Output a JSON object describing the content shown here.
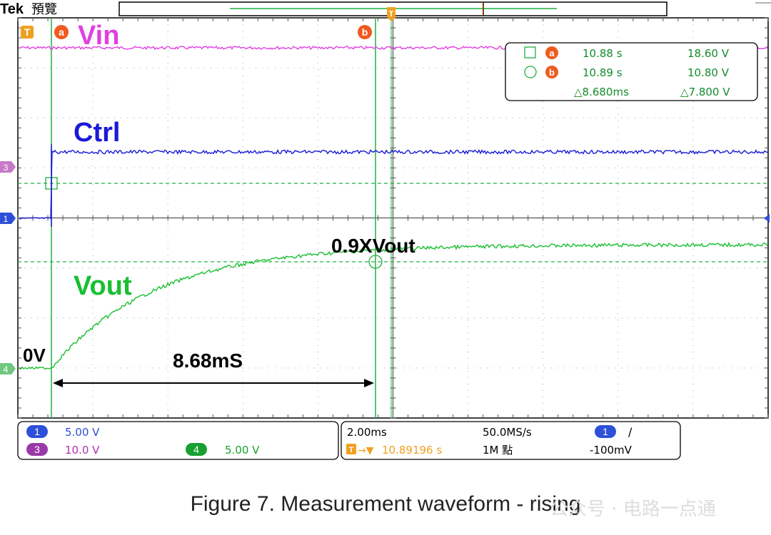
{
  "brand": "Tek",
  "acq_state": "預覽",
  "trace_labels": {
    "vin": "Vin",
    "ctrl": "Ctrl",
    "vout": "Vout"
  },
  "annotations": {
    "zero": "0V",
    "level": "0.9XVout",
    "interval": "8.68mS"
  },
  "cursor_markers": {
    "a": "a",
    "b": "b",
    "trigger": "T"
  },
  "channel_markers": {
    "ch1": "1",
    "ch3": "3",
    "ch4": "4"
  },
  "cursor_readout": {
    "a_time": "10.88 s",
    "a_volt": "18.60 V",
    "b_time": "10.89 s",
    "b_volt": "10.80 V",
    "delta_time": "△8.680ms",
    "delta_volt": "△7.800 V"
  },
  "channels": {
    "ch1": {
      "num": "1",
      "scale": "5.00 V"
    },
    "ch3": {
      "num": "3",
      "scale": "10.0 V"
    },
    "ch4": {
      "num": "4",
      "scale": "5.00 V"
    }
  },
  "timebase": {
    "scale": "2.00ms",
    "sample_rate": "50.0MS/s",
    "trigger_pos": "10.89196 s",
    "record_length": "1M 點",
    "trig_channel": "1",
    "trig_slope": "/",
    "trig_level": "-100mV"
  },
  "caption": "Figure 7. Measurement waveform - rising",
  "watermark": "公众号 · 电路一点通",
  "colors": {
    "vin": "#e040e0",
    "ctrl": "#1a1ad8",
    "vout": "#18c030",
    "cursor": "#20b040",
    "marker": "#f05a1e",
    "ch3": "#b030b0",
    "trigger": "#f0a020"
  }
}
